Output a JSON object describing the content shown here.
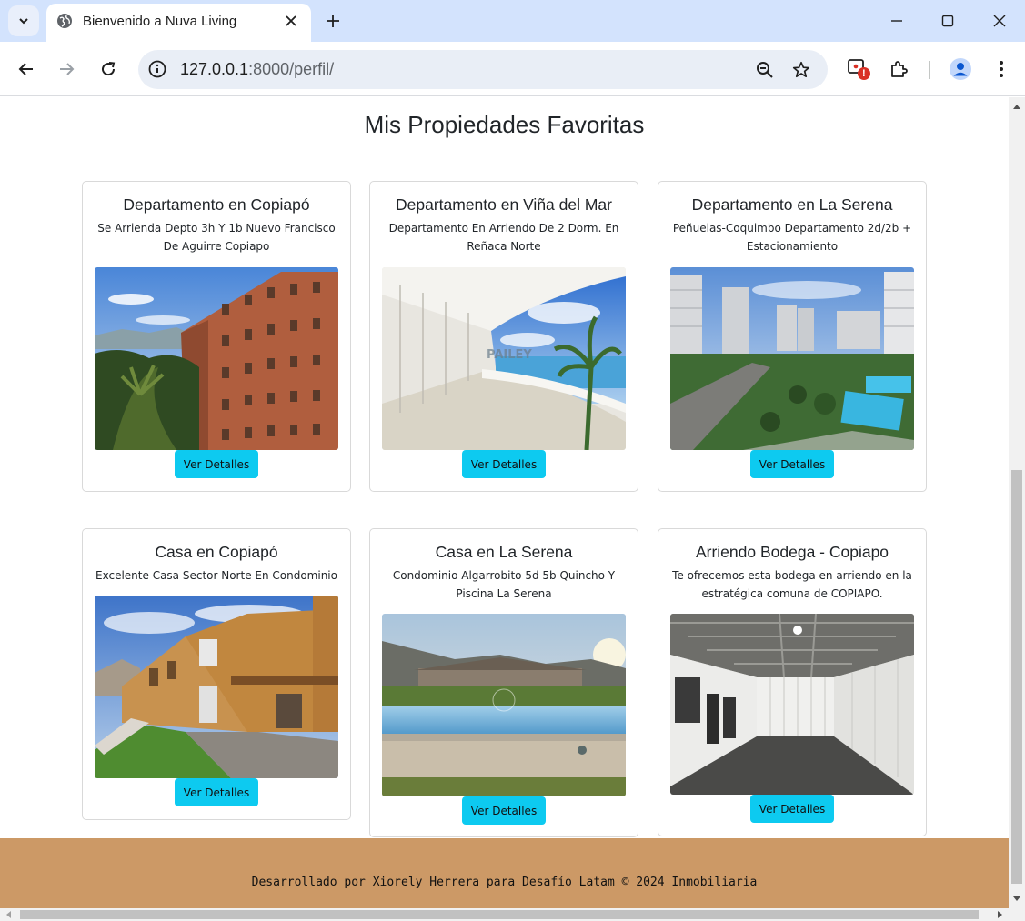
{
  "browser": {
    "tab_title": "Bienvenido a Nuva Living",
    "url_host": "127.0.0.1",
    "url_path": ":8000/perfil/",
    "extension_badge": "!"
  },
  "page": {
    "title": "Mis Propiedades Favoritas",
    "button_label": "Ver Detalles"
  },
  "cards": [
    {
      "title": "Departamento en Copiapó",
      "description": "Se Arrienda Depto 3h Y 1b Nuevo Francisco De Aguirre Copiapo",
      "image": "apartment-building-photo"
    },
    {
      "title": "Departamento en Viña del Mar",
      "description": "Departamento En Arriendo De 2 Dorm. En Reñaca Norte",
      "image": "ocean-view-terrace-photo",
      "watermark": "PAILEY"
    },
    {
      "title": "Departamento en La Serena",
      "description": "Peñuelas-Coquimbo Departamento 2d/2b + Estacionamiento",
      "image": "city-towers-pool-photo"
    },
    {
      "title": "Casa en Copiapó",
      "description": "Excelente Casa Sector Norte En Condominio",
      "image": "townhouses-photo"
    },
    {
      "title": "Casa en La Serena",
      "description": "Condominio Algarrobito 5d 5b Quincho Y Piscina La Serena",
      "image": "house-with-pool-photo"
    },
    {
      "title": "Arriendo Bodega - Copiapo",
      "description": "Te ofrecemos esta bodega en arriendo en la estratégica comuna de COPIAPO.",
      "image": "warehouse-interior-photo"
    }
  ],
  "footer": {
    "text": "Desarrollado por Xiorely Herrera para Desafío Latam © 2024 Inmobiliaria"
  }
}
